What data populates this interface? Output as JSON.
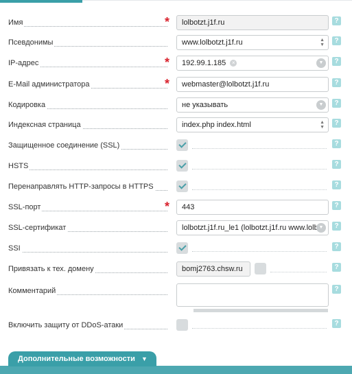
{
  "fields": {
    "name": {
      "label": "Имя",
      "value": "lolbotzt.j1f.ru"
    },
    "aliases": {
      "label": "Псевдонимы",
      "value": "www.lolbotzt.j1f.ru"
    },
    "ip": {
      "label": "IP-адрес",
      "value": "192.99.1.185"
    },
    "email": {
      "label": "E-Mail администратора",
      "value": "webmaster@lolbotzt.j1f.ru"
    },
    "encoding": {
      "label": "Кодировка",
      "value": "не указывать"
    },
    "index": {
      "label": "Индексная страница",
      "value": "index.php index.html"
    },
    "ssl": {
      "label": "Защищенное соединение (SSL)",
      "checked": true
    },
    "hsts": {
      "label": "HSTS",
      "checked": true
    },
    "redirect": {
      "label": "Перенаправлять HTTP-запросы в HTTPS",
      "checked": true
    },
    "ssl_port": {
      "label": "SSL-порт",
      "value": "443"
    },
    "ssl_cert": {
      "label": "SSL-сертификат",
      "value": "lolbotzt.j1f.ru_le1 (lolbotzt.j1f.ru www.lolb"
    },
    "ssi": {
      "label": "SSI",
      "checked": true
    },
    "tech_domain": {
      "label": "Привязать к тех. домену",
      "value": "bomj2763.chsw.ru",
      "checked": false
    },
    "comment": {
      "label": "Комментарий",
      "value": ""
    },
    "ddos": {
      "label": "Включить защиту от DDoS-атаки",
      "checked": false
    }
  },
  "help_glyph": "?",
  "required_mark": "*",
  "more": {
    "label": "Дополнительные возможности",
    "arrow": "▼"
  },
  "colors": {
    "accent": "#3a9fa8",
    "required": "#d9232e",
    "help": "#a7dcdf"
  }
}
